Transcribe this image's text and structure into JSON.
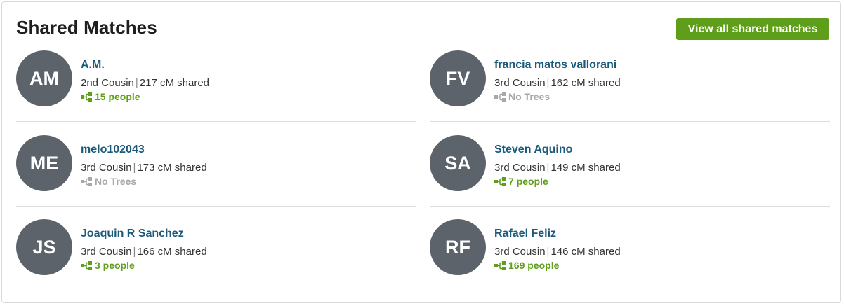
{
  "header": {
    "title": "Shared Matches",
    "view_all_label": "View all shared matches"
  },
  "colors": {
    "accent_green": "#5e9e1a",
    "link_blue": "#1b5a7a",
    "avatar_gray": "#5d636a",
    "muted_gray": "#a8a8a8"
  },
  "matches": [
    {
      "initials": "AM",
      "name": "A.M.",
      "relationship": "2nd Cousin",
      "shared": "217 cM shared",
      "tree_text": "15 people",
      "has_tree": true
    },
    {
      "initials": "FV",
      "name": "francia matos vallorani",
      "relationship": "3rd Cousin",
      "shared": "162 cM shared",
      "tree_text": "No Trees",
      "has_tree": false
    },
    {
      "initials": "ME",
      "name": "melo102043",
      "relationship": "3rd Cousin",
      "shared": "173 cM shared",
      "tree_text": "No Trees",
      "has_tree": false
    },
    {
      "initials": "SA",
      "name": "Steven Aquino",
      "relationship": "3rd Cousin",
      "shared": "149 cM shared",
      "tree_text": "7 people",
      "has_tree": true
    },
    {
      "initials": "JS",
      "name": "Joaquin R Sanchez",
      "relationship": "3rd Cousin",
      "shared": "166 cM shared",
      "tree_text": "3 people",
      "has_tree": true
    },
    {
      "initials": "RF",
      "name": "Rafael Feliz",
      "relationship": "3rd Cousin",
      "shared": "146 cM shared",
      "tree_text": "169 people",
      "has_tree": true
    }
  ]
}
